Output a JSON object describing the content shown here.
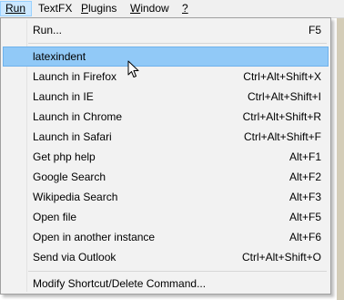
{
  "menubar": {
    "items": [
      {
        "label": "Run",
        "accel_prefix": "",
        "accel": "R",
        "rest": "un"
      },
      {
        "label": "TextFX"
      },
      {
        "label": "Plugins",
        "accel": "P",
        "rest": "lugins"
      },
      {
        "label": "Window",
        "accel": "W",
        "rest": "indow"
      },
      {
        "label": "?",
        "accel": "?",
        "rest": ""
      }
    ]
  },
  "run_menu": {
    "items": [
      {
        "label": "Run...",
        "shortcut": "F5"
      },
      {
        "label": "latexindent",
        "shortcut": ""
      },
      {
        "label": "Launch in Firefox",
        "shortcut": "Ctrl+Alt+Shift+X"
      },
      {
        "label": "Launch in IE",
        "shortcut": "Ctrl+Alt+Shift+I"
      },
      {
        "label": "Launch in Chrome",
        "shortcut": "Ctrl+Alt+Shift+R"
      },
      {
        "label": "Launch in Safari",
        "shortcut": "Ctrl+Alt+Shift+F"
      },
      {
        "label": "Get php help",
        "shortcut": "Alt+F1"
      },
      {
        "label": "Google Search",
        "shortcut": "Alt+F2"
      },
      {
        "label": "Wikipedia Search",
        "shortcut": "Alt+F3"
      },
      {
        "label": "Open file",
        "shortcut": "Alt+F5"
      },
      {
        "label": "Open in another instance",
        "shortcut": "Alt+F6"
      },
      {
        "label": "Send via Outlook",
        "shortcut": "Ctrl+Alt+Shift+O"
      },
      {
        "label": "Modify Shortcut/Delete Command...",
        "shortcut": ""
      }
    ],
    "selected_label": "latexindent"
  },
  "colors": {
    "menu_bg": "#f2f2f2",
    "highlight": "#91c9f7",
    "menubar_active": "#cce8ff"
  },
  "icons": {
    "cursor": "mouse-pointer-icon"
  }
}
